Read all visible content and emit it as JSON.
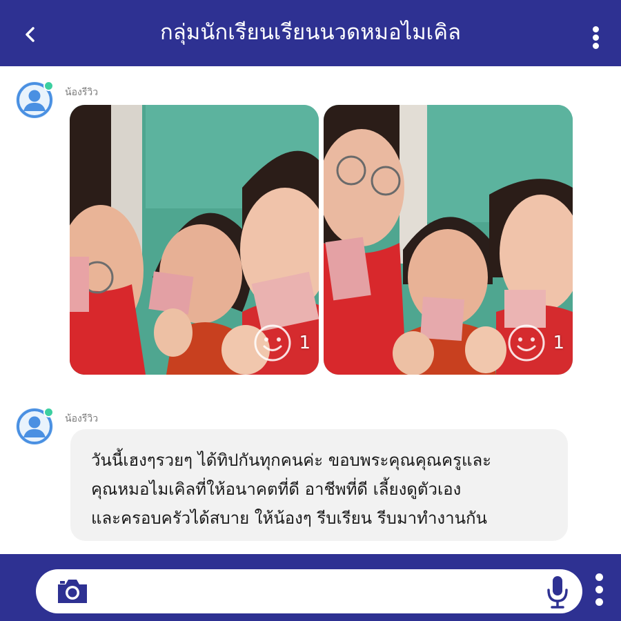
{
  "header": {
    "title": "กลุ่มนักเรียนเรียนนวดหมอไมเคิล",
    "back_icon": "chevron-left-icon",
    "menu_icon": "more-vertical-icon"
  },
  "messages": [
    {
      "sender": "น้องรีวิว",
      "type": "photos",
      "photos": [
        {
          "reaction_count": "1"
        },
        {
          "reaction_count": "1"
        }
      ]
    },
    {
      "sender": "น้องรีวิว",
      "type": "text",
      "lines": [
        "วันนี้เฮงๆรวยๆ ได้ทิปกันทุกคนค่ะ ขอบพระคุณคุณครูและ",
        "คุณหมอไมเคิลที่ให้อนาคตที่ดี อาชีพที่ดี เลี้ยงดูตัวเอง",
        "และครอบครัวได้สบาย ให้น้องๆ รีบเรียน รีบมาทำงานกัน"
      ]
    }
  ],
  "footer": {
    "camera_icon": "camera-icon",
    "mic_icon": "microphone-icon",
    "menu_icon": "more-vertical-icon"
  },
  "colors": {
    "brand": "#2e3192",
    "online": "#3ccfa0",
    "avatar": "#4a90e2",
    "bubble": "#f2f2f2"
  }
}
